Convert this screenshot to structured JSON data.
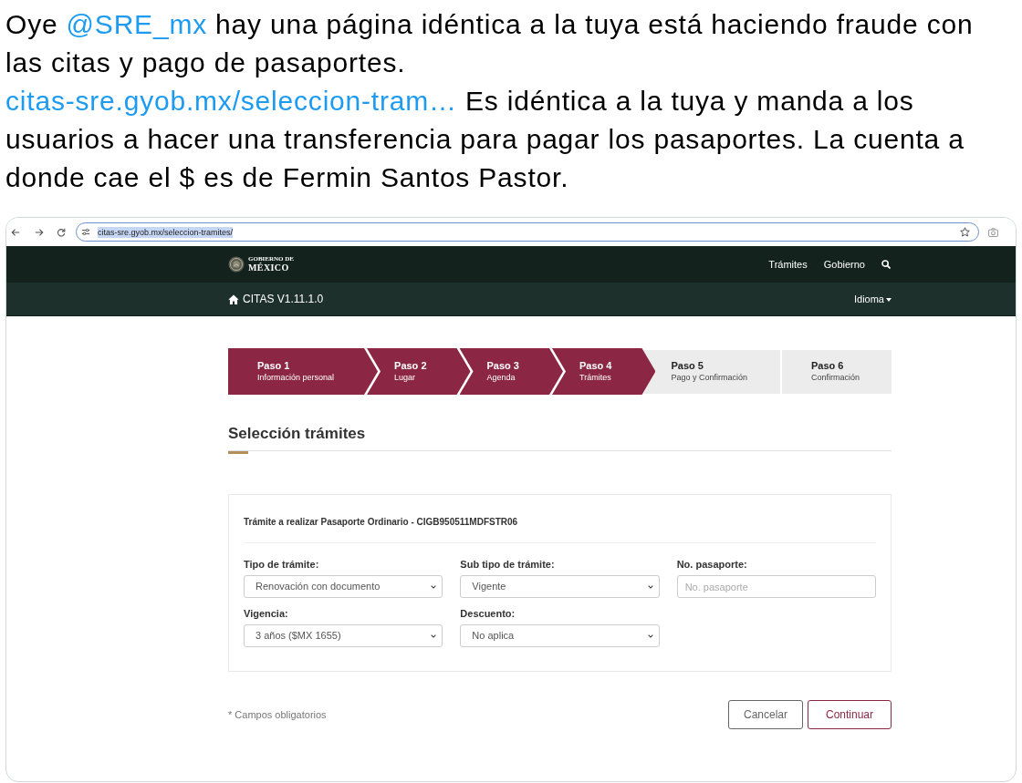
{
  "tweet": {
    "paragraphs": [
      {
        "segments": [
          {
            "kind": "text",
            "text": "Oye "
          },
          {
            "kind": "mention",
            "text": "@SRE_mx"
          },
          {
            "kind": "text",
            "text": " hay una página idéntica a la tuya está haciendo fraude con las citas y pago de pasaportes."
          }
        ]
      },
      {
        "segments": [
          {
            "kind": "link",
            "text": "citas-sre.gyob.mx/seleccion-tram…"
          },
          {
            "kind": "text",
            "text": " Es idéntica a la tuya y manda a los usuarios a hacer una transferencia para pagar los pasaportes. La cuenta a donde cae el $ es de Fermin Santos Pastor."
          }
        ]
      }
    ]
  },
  "browser": {
    "url": "citas-sre.gyob.mx/seleccion-tramites/",
    "url_selected": true
  },
  "site_header": {
    "logo_lines": [
      "GOBIERNO DE",
      "MÉXICO"
    ],
    "nav": [
      "Trámites",
      "Gobierno"
    ]
  },
  "app_bar": {
    "title": "CITAS V1.11.1.0",
    "language_menu": "Idioma"
  },
  "steps": [
    {
      "label": "Paso 1",
      "caption": "Información personal",
      "completed": true
    },
    {
      "label": "Paso 2",
      "caption": "Lugar",
      "completed": true
    },
    {
      "label": "Paso 3",
      "caption": "Agenda",
      "completed": true
    },
    {
      "label": "Paso 4",
      "caption": "Trámites",
      "completed": true
    },
    {
      "label": "Paso 5",
      "caption": "Pago y Confirmación",
      "completed": false
    },
    {
      "label": "Paso 6",
      "caption": "Confirmación",
      "completed": false
    }
  ],
  "section_title": "Selección trámites",
  "form": {
    "heading": "Trámite a realizar Pasaporte Ordinario - CIGB950511MDFSTR06",
    "fields": [
      {
        "kind": "select",
        "label": "Tipo de trámite:",
        "value": "Renovación con documento"
      },
      {
        "kind": "select",
        "label": "Sub tipo de trámite:",
        "value": "Vigente"
      },
      {
        "kind": "text",
        "label": "No. pasaporte:",
        "placeholder": "No. pasaporte"
      },
      {
        "kind": "select",
        "label": "Vigencia:",
        "value": "3 años ($MX 1655)"
      },
      {
        "kind": "select",
        "label": "Descuento:",
        "value": "No aplica"
      }
    ]
  },
  "footnote": "* Campos obligatorios",
  "buttons": [
    {
      "kind": "secondary",
      "label": "Cancelar"
    },
    {
      "kind": "primary",
      "label": "Continuar"
    }
  ]
}
